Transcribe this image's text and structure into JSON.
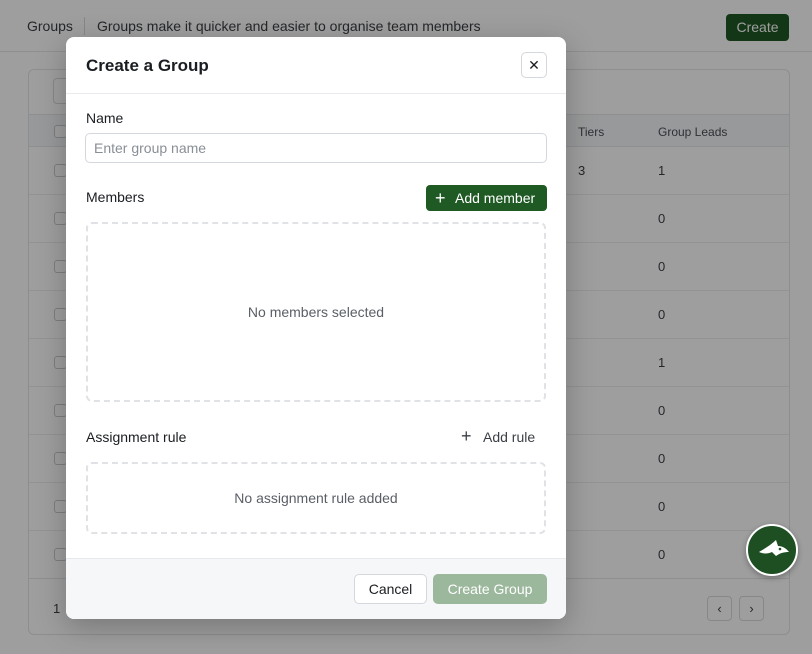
{
  "header": {
    "breadcrumb": "Groups",
    "description": "Groups make it quicker and easier to organise team members",
    "create_label": "Create"
  },
  "table": {
    "columns": [
      "Tiers",
      "Group Leads"
    ],
    "rows": [
      {
        "tiers": "3",
        "group_leads": "1"
      },
      {
        "tiers": "",
        "group_leads": "0"
      },
      {
        "tiers": "",
        "group_leads": "0"
      },
      {
        "tiers": "",
        "group_leads": "0"
      },
      {
        "tiers": "",
        "group_leads": "1"
      },
      {
        "tiers": "",
        "group_leads": "0"
      },
      {
        "tiers": "",
        "group_leads": "0"
      },
      {
        "tiers": "",
        "group_leads": "0"
      },
      {
        "tiers": "",
        "group_leads": "0"
      }
    ],
    "page": "1",
    "prev_icon": "‹",
    "next_icon": "›"
  },
  "modal": {
    "title": "Create a Group",
    "close_icon": "✕",
    "name_label": "Name",
    "name_placeholder": "Enter group name",
    "name_value": "",
    "members_label": "Members",
    "add_member_label": "Add member",
    "members_empty": "No members selected",
    "assignment_label": "Assignment rule",
    "add_rule_label": "Add rule",
    "assignment_empty": "No assignment rule added",
    "cancel_label": "Cancel",
    "submit_label": "Create Group"
  },
  "colors": {
    "brand": "#1f5a24",
    "brand_disabled": "#9bb79c"
  }
}
